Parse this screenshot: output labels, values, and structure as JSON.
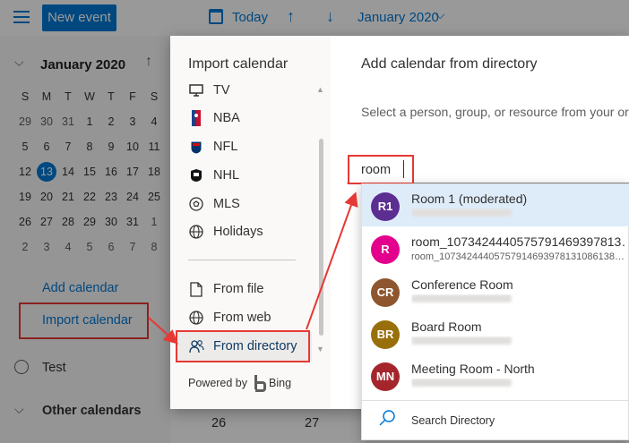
{
  "topbar": {
    "new_event": "New event",
    "today": "Today",
    "month": "January 2020"
  },
  "mini_calendar": {
    "title": "January 2020",
    "weekdays": [
      "S",
      "M",
      "T",
      "W",
      "T",
      "F",
      "S"
    ],
    "weeks": [
      [
        "29",
        "30",
        "31",
        "1",
        "2",
        "3",
        "4"
      ],
      [
        "5",
        "6",
        "7",
        "8",
        "9",
        "10",
        "11"
      ],
      [
        "12",
        "13",
        "14",
        "15",
        "16",
        "17",
        "18"
      ],
      [
        "19",
        "20",
        "21",
        "22",
        "23",
        "24",
        "25"
      ],
      [
        "26",
        "27",
        "28",
        "29",
        "30",
        "31",
        "1"
      ],
      [
        "2",
        "3",
        "4",
        "5",
        "6",
        "7",
        "8"
      ]
    ],
    "today": "13"
  },
  "left_nav": {
    "add_calendar": "Add calendar",
    "import_calendar": "Import calendar",
    "test": "Test",
    "other_calendars": "Other calendars"
  },
  "calendar_bottom": {
    "day_a": "26",
    "day_b": "27"
  },
  "dialog": {
    "left_title": "Import calendar",
    "menu": [
      {
        "label": "TV",
        "icon": "tv-icon"
      },
      {
        "label": "NBA",
        "icon": "nba-icon"
      },
      {
        "label": "NFL",
        "icon": "nfl-icon"
      },
      {
        "label": "NHL",
        "icon": "nhl-icon"
      },
      {
        "label": "MLS",
        "icon": "mls-icon"
      },
      {
        "label": "Holidays",
        "icon": "globe-icon"
      },
      {
        "label": "From file",
        "icon": "file-icon"
      },
      {
        "label": "From web",
        "icon": "globe-icon"
      },
      {
        "label": "From directory",
        "icon": "people-icon"
      }
    ],
    "powered_by": "Powered by",
    "bing": "Bing",
    "right_title": "Add calendar from directory",
    "right_desc": "Select a person, group, or resource from your organization",
    "search_value": "room"
  },
  "dropdown": {
    "items": [
      {
        "initials": "R1",
        "name": "Room 1 (moderated)",
        "sub": "",
        "color": "#5c2e91"
      },
      {
        "initials": "R",
        "name": "room_1073424440575791469397813…",
        "sub": "room_10734244405757914693978131086138…",
        "color": "#e3008c"
      },
      {
        "initials": "CR",
        "name": "Conference Room",
        "sub": "",
        "color": "#8e562e"
      },
      {
        "initials": "BR",
        "name": "Board Room",
        "sub": "",
        "color": "#986f0b"
      },
      {
        "initials": "MN",
        "name": "Meeting Room - North",
        "sub": "",
        "color": "#a4262c"
      }
    ],
    "search_directory": "Search Directory"
  },
  "colors": {
    "accent": "#0078d4",
    "annotation": "#e53935"
  }
}
